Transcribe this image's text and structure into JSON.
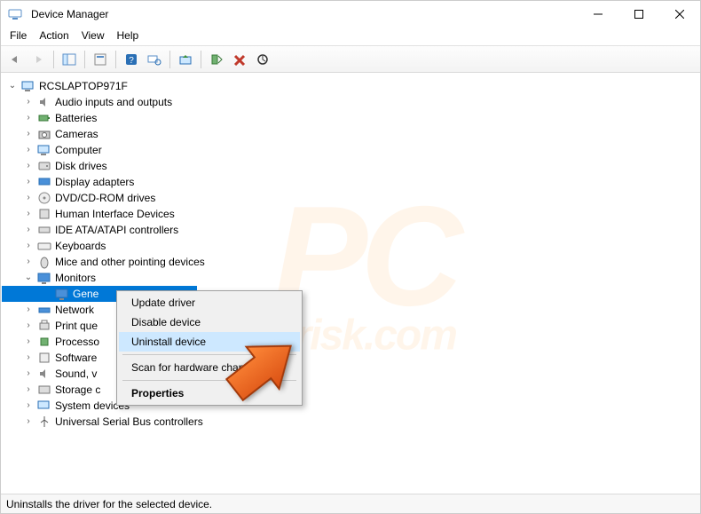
{
  "window": {
    "title": "Device Manager"
  },
  "menus": {
    "file": "File",
    "action": "Action",
    "view": "View",
    "help": "Help"
  },
  "tree": {
    "root": "RCSLAPTOP971F",
    "items": {
      "audio": "Audio inputs and outputs",
      "batteries": "Batteries",
      "cameras": "Cameras",
      "computer": "Computer",
      "disk": "Disk drives",
      "display": "Display adapters",
      "dvd": "DVD/CD-ROM drives",
      "hid": "Human Interface Devices",
      "ide": "IDE ATA/ATAPI controllers",
      "keyboards": "Keyboards",
      "mice": "Mice and other pointing devices",
      "monitors": "Monitors",
      "monitor_child": "Gene",
      "network": "Network",
      "printq": "Print que",
      "processors": "Processo",
      "software": "Software",
      "sound": "Sound, v",
      "storage": "Storage c",
      "system": "System devices",
      "usb": "Universal Serial Bus controllers"
    }
  },
  "context_menu": {
    "update": "Update driver",
    "disable": "Disable device",
    "uninstall": "Uninstall device",
    "scan": "Scan for hardware changes",
    "properties": "Properties"
  },
  "statusbar": {
    "text": "Uninstalls the driver for the selected device."
  },
  "watermark": {
    "main": "PC",
    "sub": "risk.com"
  }
}
